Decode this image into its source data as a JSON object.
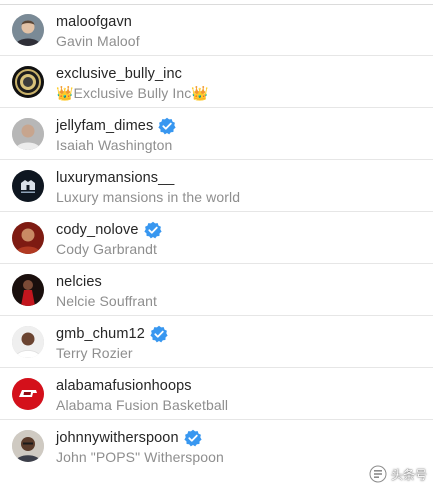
{
  "colors": {
    "username": "#262626",
    "fullname": "#8e8e8e",
    "verified_badge": "#3897f0",
    "divider": "#e6e6e6"
  },
  "rows": [
    {
      "username": "maloofgavn",
      "fullname": "Gavin Maloof",
      "verified": false,
      "avatar_icon": "person-photo"
    },
    {
      "username": "exclusive_bully_inc",
      "fullname": "👑Exclusive Bully Inc👑",
      "verified": false,
      "avatar_icon": "logo-badge"
    },
    {
      "username": "jellyfam_dimes",
      "fullname": "Isaiah Washington",
      "verified": true,
      "avatar_icon": "person-photo"
    },
    {
      "username": "luxurymansions__",
      "fullname": "Luxury mansions in the world",
      "verified": false,
      "avatar_icon": "brand-logo"
    },
    {
      "username": "cody_nolove",
      "fullname": "Cody Garbrandt",
      "verified": true,
      "avatar_icon": "person-photo"
    },
    {
      "username": "nelcies",
      "fullname": "Nelcie Souffrant",
      "verified": false,
      "avatar_icon": "person-photo"
    },
    {
      "username": "gmb_chum12",
      "fullname": "Terry Rozier",
      "verified": true,
      "avatar_icon": "person-photo"
    },
    {
      "username": "alabamafusionhoops",
      "fullname": "Alabama Fusion Basketball",
      "verified": false,
      "avatar_icon": "team-logo"
    },
    {
      "username": "johnnywitherspoon",
      "fullname": "John \"POPS\" Witherspoon",
      "verified": true,
      "avatar_icon": "person-photo"
    }
  ],
  "watermark": {
    "text": "头条号",
    "icon": "toutiao-icon"
  }
}
